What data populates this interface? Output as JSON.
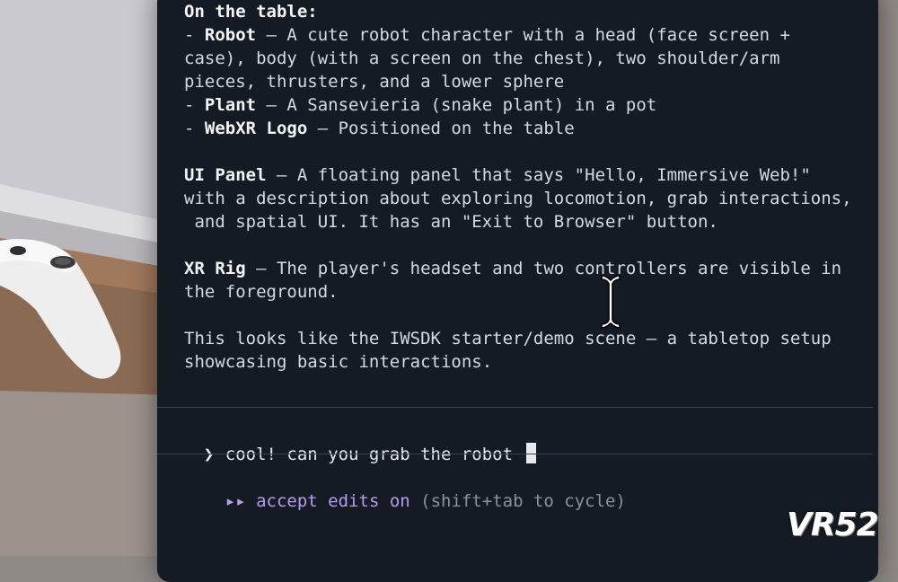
{
  "terminal": {
    "lines": [
      {
        "bold": "On the table:",
        "text": ""
      },
      {
        "prefix": "- ",
        "bold": "Robot",
        "text": " – A cute robot character with a head (face screen +"
      },
      {
        "text": "case), body (with a screen on the chest), two shoulder/arm"
      },
      {
        "text": "pieces, thrusters, and a lower sphere"
      },
      {
        "prefix": "- ",
        "bold": "Plant",
        "text": " – A Sansevieria (snake plant) in a pot"
      },
      {
        "prefix": "- ",
        "bold": "WebXR Logo",
        "text": " – Positioned on the table"
      },
      {
        "text": ""
      },
      {
        "bold": "UI Panel",
        "text": " – A floating panel that says \"Hello, Immersive Web!\""
      },
      {
        "text": "with a description about exploring locomotion, grab interactions,"
      },
      {
        "text": " and spatial UI. It has an \"Exit to Browser\" button."
      },
      {
        "text": ""
      },
      {
        "bold": "XR Rig",
        "text": " – The player's headset and two controllers are visible in"
      },
      {
        "text": "the foreground."
      },
      {
        "text": ""
      },
      {
        "text": "This looks like the IWSDK starter/demo scene – a tabletop setup"
      },
      {
        "text": "showcasing basic interactions."
      }
    ],
    "prompt_symbol": "❯",
    "input_value": "cool! can you grab the robot ",
    "status_arrows": "▸▸",
    "status_mode": "accept edits on",
    "status_hint": "(shift+tab to cycle)"
  },
  "watermark": "VR52",
  "colors": {
    "terminal_bg": "#151b22",
    "text": "#d6dae0",
    "accent": "#b49cf0",
    "muted": "#8b929c"
  }
}
